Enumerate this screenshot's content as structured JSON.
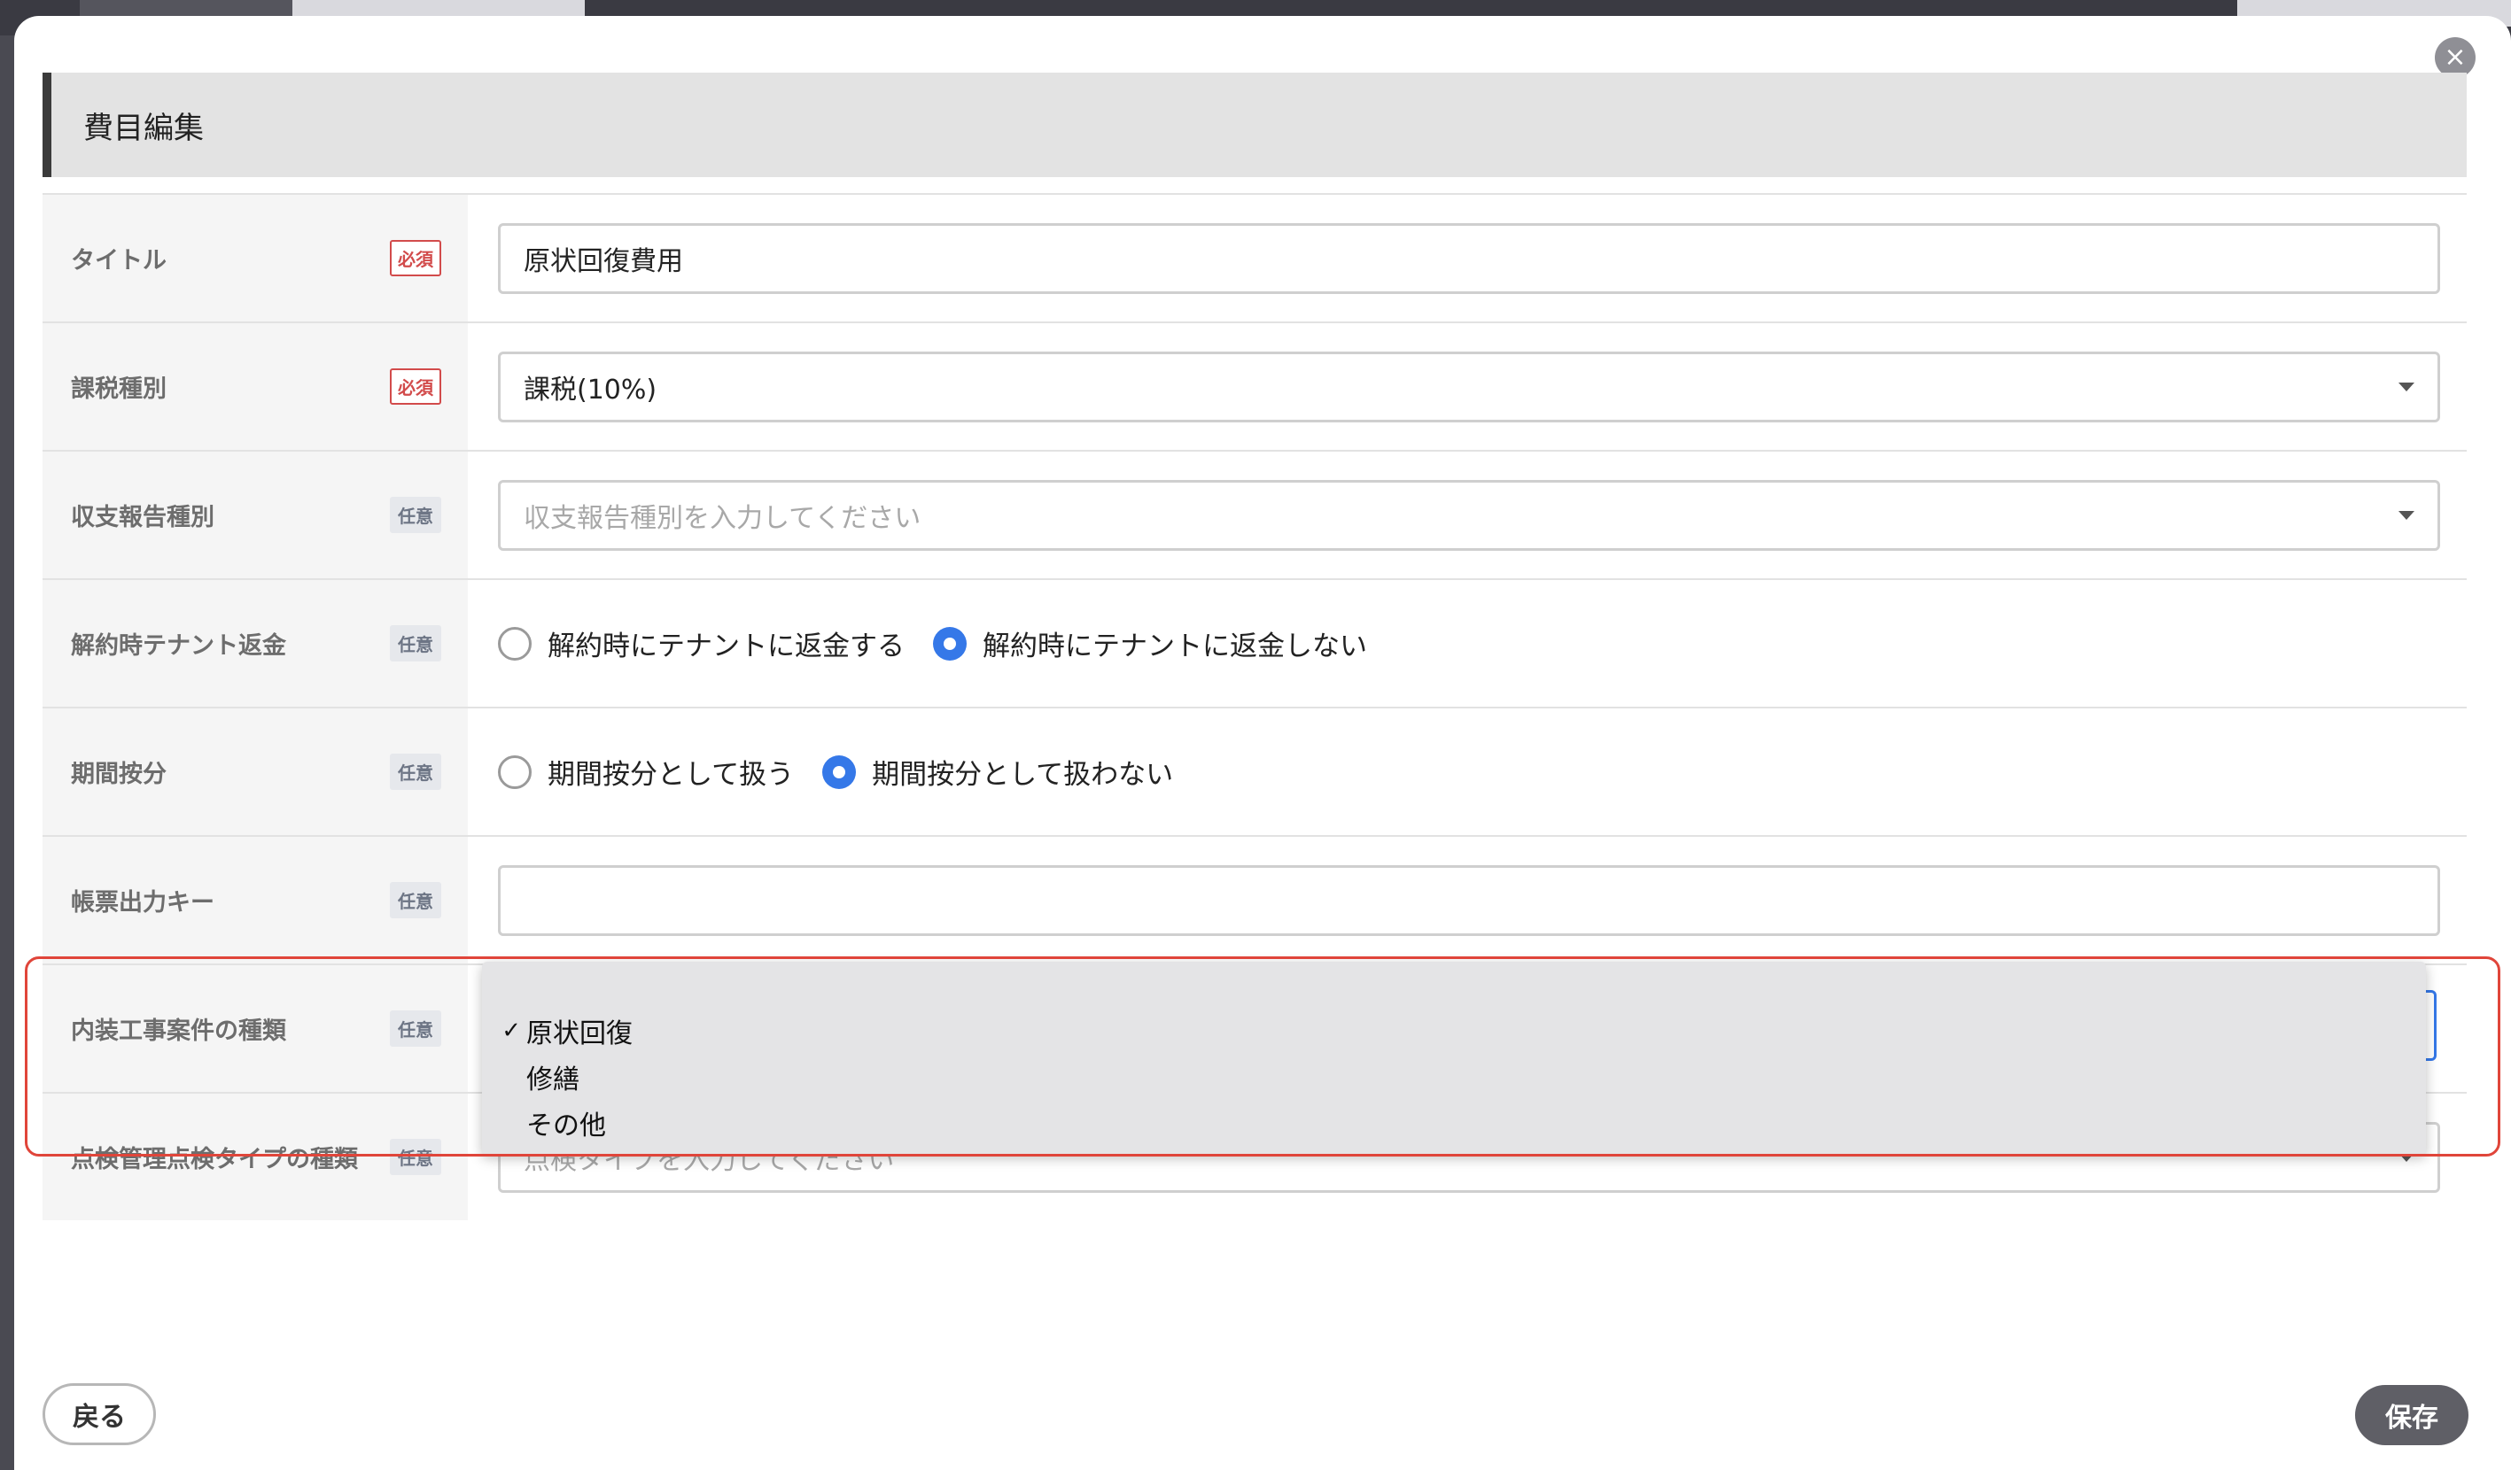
{
  "modal": {
    "title": "費目編集",
    "close_icon": "×"
  },
  "badges": {
    "required": "必須",
    "optional": "任意"
  },
  "fields": {
    "title": {
      "label": "タイトル",
      "badge": "必須",
      "value": "原状回復費用"
    },
    "tax_type": {
      "label": "課税種別",
      "badge": "必須",
      "value": "課税(10%)"
    },
    "income_report_type": {
      "label": "収支報告種別",
      "badge": "任意",
      "placeholder": "収支報告種別を入力してください"
    },
    "tenant_refund": {
      "label": "解約時テナント返金",
      "badge": "任意",
      "options": [
        "解約時にテナントに返金する",
        "解約時にテナントに返金しない"
      ],
      "selected_index": 1
    },
    "period_allocation": {
      "label": "期間按分",
      "badge": "任意",
      "options": [
        "期間按分として扱う",
        "期間按分として扱わない"
      ],
      "selected_index": 1
    },
    "report_output_key": {
      "label": "帳票出力キー",
      "badge": "任意",
      "value": ""
    },
    "interior_work_type": {
      "label": "内装工事案件の種類",
      "badge": "任意",
      "dropdown_options": [
        "原状回復",
        "修繕",
        "その他"
      ],
      "selected": "原状回復",
      "check_mark": "✓"
    },
    "inspection_type": {
      "label": "点検管理点検タイプの種類",
      "badge": "任意",
      "placeholder": "点検タイプを入力してください"
    }
  },
  "footer": {
    "back_label": "戻る",
    "save_label": "保存"
  },
  "colors": {
    "accent": "#3578e8",
    "highlight": "#e0453a",
    "required": "#d24b4b"
  }
}
